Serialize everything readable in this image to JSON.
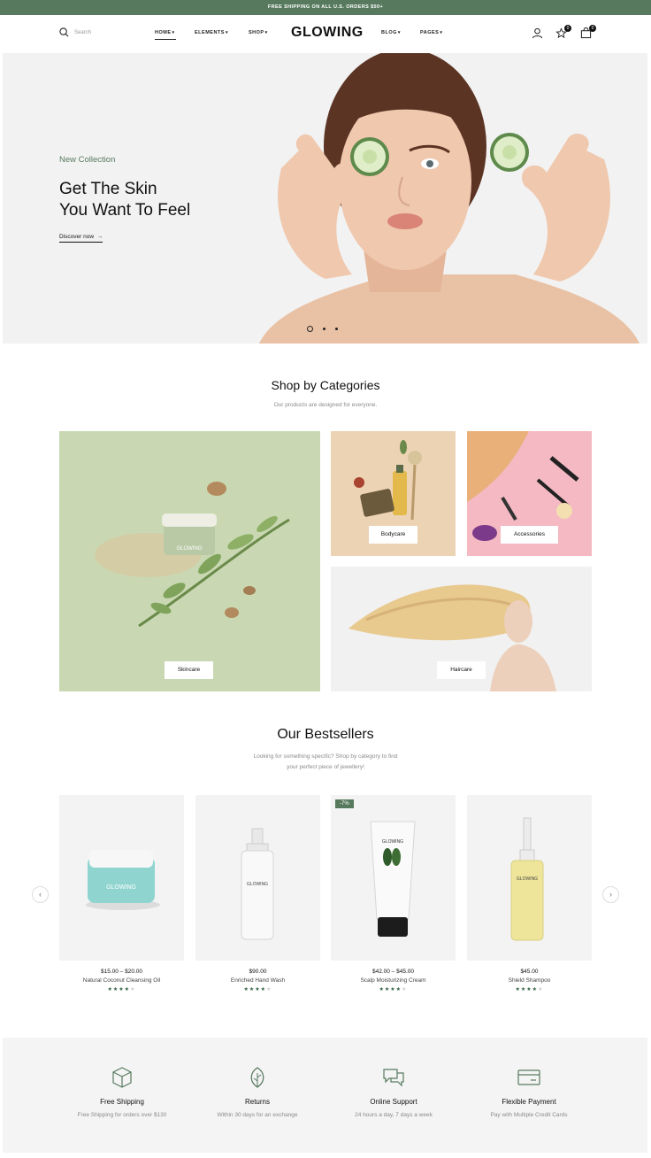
{
  "topbar": {
    "text": "FREE SHIPPING ON ALL U.S. ORDERS $50+"
  },
  "header": {
    "search_placeholder": "Search",
    "nav_left": [
      "HOME",
      "ELEMENTS",
      "SHOP"
    ],
    "logo": "GLOWING",
    "nav_right": [
      "BLOG",
      "PAGES"
    ],
    "wishlist_count": "0",
    "cart_count": "0"
  },
  "hero": {
    "eyebrow": "New Collection",
    "title_line1": "Get The Skin",
    "title_line2": "You Want To Feel",
    "link": "Discover now",
    "slides": 3,
    "active_slide": 1
  },
  "categories": {
    "title": "Shop by Categories",
    "subtitle": "Our products are designed for everyone.",
    "items": [
      {
        "label": "Skincare"
      },
      {
        "label": "Bodycare"
      },
      {
        "label": "Accessories"
      },
      {
        "label": "Haircare"
      }
    ]
  },
  "bestsellers": {
    "title": "Our Bestsellers",
    "subtitle_line1": "Looking for something specific? Shop by category to find",
    "subtitle_line2": "your perfect piece of jewellery!",
    "products": [
      {
        "price": "$15.00 – $20.00",
        "name": "Natural Coconut Cleansing Oil",
        "rating": 4,
        "badge": ""
      },
      {
        "price": "$90.00",
        "name": "Enriched Hand Wash",
        "rating": 4,
        "badge": ""
      },
      {
        "price": "$42.00 – $45.00",
        "name": "Scalp Moisturizing Cream",
        "rating": 4,
        "badge": "-7%"
      },
      {
        "price": "$45.00",
        "name": "Shield Shampoo",
        "rating": 4,
        "badge": ""
      }
    ],
    "product_brand": "GLOWING"
  },
  "features": [
    {
      "title": "Free Shipping",
      "subtitle": "Free Shipping for orders over $130",
      "icon": "box-icon"
    },
    {
      "title": "Returns",
      "subtitle": "Within 30 days for an exchange",
      "icon": "leaf-icon"
    },
    {
      "title": "Online Support",
      "subtitle": "24 hours a day, 7 days a week",
      "icon": "chat-icon"
    },
    {
      "title": "Flexible Payment",
      "subtitle": "Pay with Multiple Credit Cards",
      "icon": "card-icon"
    }
  ],
  "colors": {
    "accent": "#577a5f",
    "hero_bg": "#f2f2f2",
    "skincare_bg": "#c9d8b2",
    "bodycare_bg": "#ecd3b4",
    "accessories_bg": "#f4b9c2"
  }
}
